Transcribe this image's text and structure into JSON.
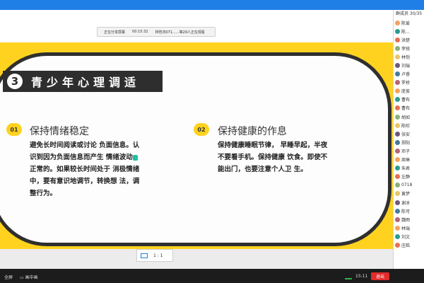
{
  "meeting": {
    "share_status": "正在分享屏幕",
    "timer": "00:15:32",
    "viewers": "林恺鸿071......等29人正在观看"
  },
  "slide": {
    "section_number": "3",
    "section_title": "青少年心理调适",
    "items": [
      {
        "num": "01",
        "title": "保持情绪稳定",
        "lines": [
          "避免长时间阅读或讨论 负面信息。认",
          "识到因为负面信息而产生 情绪波动",
          "正常的。如果较长时间处于 消极情绪",
          "中，要有意识地调节，转换想 法，调",
          "整行为。"
        ]
      },
      {
        "num": "02",
        "title": "保持健康的作息",
        "lines": [
          "保持健康睡眠节律， 早睡早起，半夜",
          "不要看手机。保持健康 饮食。即使不",
          "能出门，也要注意个人卫 生。"
        ]
      }
    ]
  },
  "panel": {
    "header": "群成员 30/35",
    "members": [
      "陈爱",
      "陈…",
      "洪楚",
      "李锐",
      "林恺",
      "刘瑞",
      "卢睿",
      "罗桥",
      "庞俊",
      "曹布",
      "曹布",
      "胡如",
      "陈吹",
      "张安",
      "郑阳",
      "邓子",
      "周琳",
      "朱君",
      "左静",
      "0718",
      "黄梦",
      "谢冰",
      "陈可",
      "魏雨",
      "林瑞",
      "刘文",
      "庄皓"
    ]
  },
  "ratio": {
    "label": "1 : 1"
  },
  "bottom": {
    "fullscreen": "全屏",
    "layout": "画中画",
    "time": "15:11",
    "exit": "退出"
  },
  "colors": {
    "accent_yellow": "#ffd21f",
    "title_bar": "#2e2e2e",
    "window_blue": "#1f7fe6",
    "exit_red": "#e22b2b"
  }
}
